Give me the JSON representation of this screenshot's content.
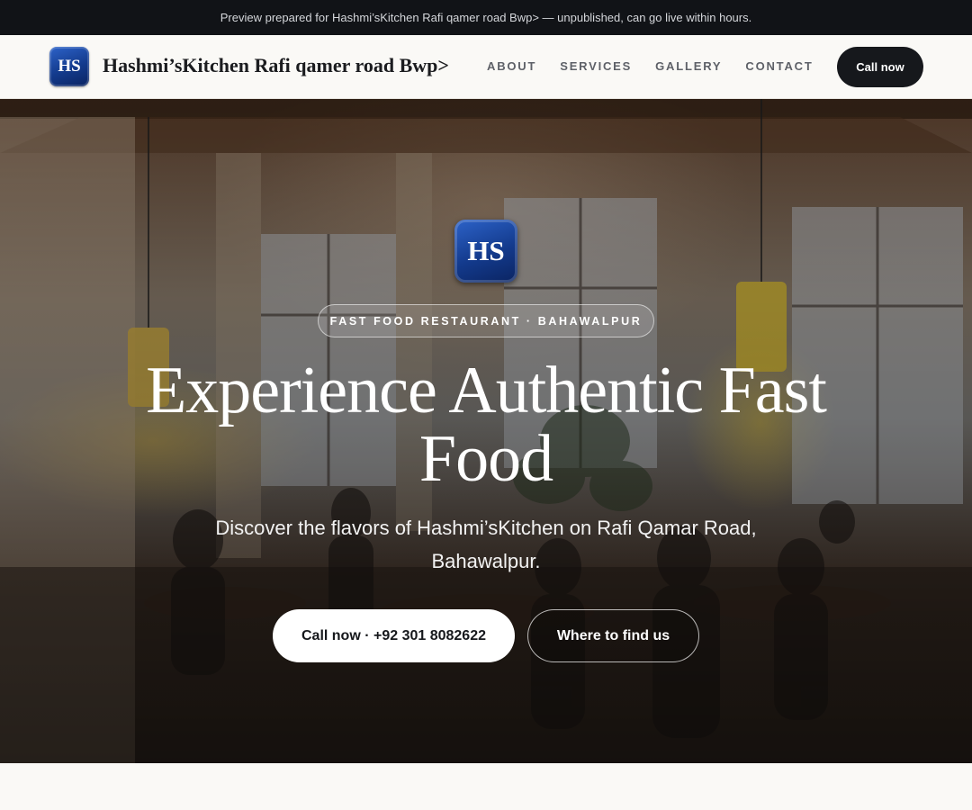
{
  "preview_bar": {
    "text": "Preview prepared for Hashmi’sKitchen Rafi qamer road Bwp> — unpublished, can go live within hours."
  },
  "header": {
    "logo_initials": "HS",
    "brand_name": "Hashmi’sKitchen Rafi qamer road Bwp>",
    "nav_items": [
      {
        "label": "ABOUT"
      },
      {
        "label": "SERVICES"
      },
      {
        "label": "GALLERY"
      },
      {
        "label": "CONTACT"
      }
    ],
    "cta_label": "Call now"
  },
  "hero": {
    "logo_initials": "HS",
    "tag": "FAST FOOD RESTAURANT · BAHAWALPUR",
    "title": "Experience Authentic Fast Food",
    "subtitle": "Discover the flavors of Hashmi’sKitchen on Rafi Qamar Road, Bahawalpur.",
    "primary_button": "Call now · +92 301 8082622",
    "secondary_button": "Where to find us",
    "background_image": "restaurant-interior-photo"
  },
  "colors": {
    "preview_bar_bg": "#111317",
    "nav_bg": "#faf9f6",
    "logo_blue": "#133a8c",
    "dark_button": "#16181c",
    "hero_text": "#ffffff"
  }
}
